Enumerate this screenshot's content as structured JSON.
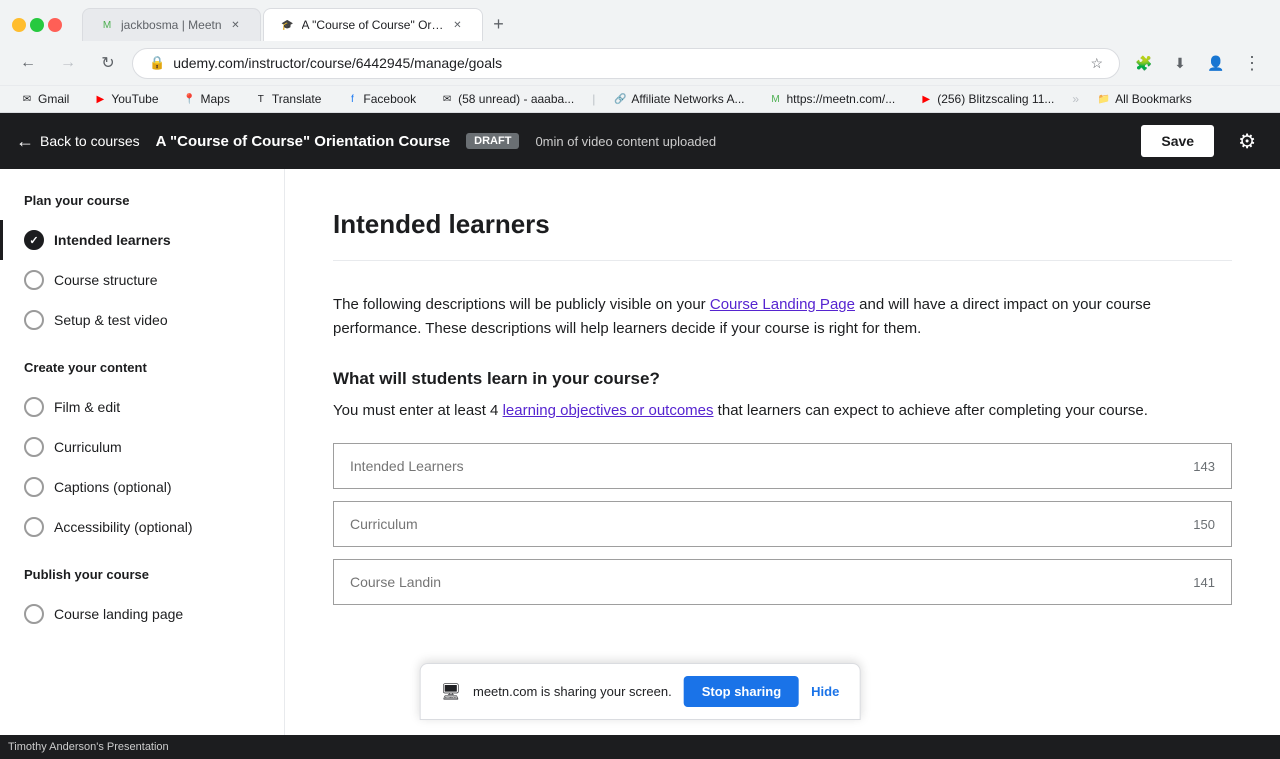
{
  "browser": {
    "tabs": [
      {
        "id": "tab1",
        "favicon": "M",
        "title": "jackbosma | Meetn",
        "active": false,
        "favicon_color": "#4CAF50"
      },
      {
        "id": "tab2",
        "favicon": "🎓",
        "title": "A \"Course of Course\" Orientati...",
        "active": true,
        "favicon_color": "#1a73e8"
      }
    ],
    "add_tab_label": "+",
    "address": "udemy.com/instructor/course/6442945/manage/goals",
    "nav": {
      "back_disabled": false,
      "forward_disabled": false,
      "reload_title": "Reload"
    },
    "bookmarks": [
      {
        "id": "bm1",
        "icon": "✉",
        "label": "Gmail"
      },
      {
        "id": "bm2",
        "icon": "▶",
        "label": "YouTube"
      },
      {
        "id": "bm3",
        "icon": "📍",
        "label": "Maps"
      },
      {
        "id": "bm4",
        "icon": "T",
        "label": "Translate"
      },
      {
        "id": "bm5",
        "icon": "f",
        "label": "Facebook"
      },
      {
        "id": "bm6",
        "icon": "✉",
        "label": "(58 unread) - aaaba..."
      },
      {
        "id": "bm7",
        "icon": "🔗",
        "label": "Affiliate Networks A..."
      },
      {
        "id": "bm8",
        "icon": "M",
        "label": "https://meetn.com/..."
      },
      {
        "id": "bm9",
        "icon": "▶",
        "label": "(256) Blitzscaling 11..."
      },
      {
        "id": "bm10",
        "icon": "📁",
        "label": "All Bookmarks"
      }
    ]
  },
  "app_header": {
    "back_label": "Back to courses",
    "course_title": "A \"Course of Course\" Orientation Course",
    "draft_label": "DRAFT",
    "video_status": "0min of video content uploaded",
    "save_label": "Save"
  },
  "sidebar": {
    "section1_title": "Plan your course",
    "section1_items": [
      {
        "id": "intended-learners",
        "label": "Intended learners",
        "completed": true,
        "active": true
      },
      {
        "id": "course-structure",
        "label": "Course structure",
        "completed": false,
        "active": false
      },
      {
        "id": "setup-test-video",
        "label": "Setup & test video",
        "completed": false,
        "active": false
      }
    ],
    "section2_title": "Create your content",
    "section2_items": [
      {
        "id": "film-edit",
        "label": "Film & edit",
        "completed": false,
        "active": false
      },
      {
        "id": "curriculum",
        "label": "Curriculum",
        "completed": false,
        "active": false
      },
      {
        "id": "captions",
        "label": "Captions (optional)",
        "completed": false,
        "active": false
      },
      {
        "id": "accessibility",
        "label": "Accessibility (optional)",
        "completed": false,
        "active": false
      }
    ],
    "section3_title": "Publish your course",
    "section3_items": [
      {
        "id": "course-landing-page",
        "label": "Course landing page",
        "completed": false,
        "active": false
      }
    ]
  },
  "content": {
    "page_title": "Intended learners",
    "description": "The following descriptions will be publicly visible on your ",
    "description_link": "Course Landing Page",
    "description_suffix": " and will have a direct impact on your course performance. These descriptions will help learners decide if your course is right for them.",
    "section_heading": "What will students learn in your course?",
    "sub_text_prefix": "You must enter at least 4 ",
    "sub_text_link": "learning objectives or outcomes",
    "sub_text_suffix": " that learners can expect to achieve after completing your course.",
    "inputs": [
      {
        "id": "input1",
        "placeholder": "Intended Learners",
        "char_count": "143"
      },
      {
        "id": "input2",
        "placeholder": "Curriculum",
        "char_count": "150"
      },
      {
        "id": "input3",
        "placeholder": "Course Landin",
        "char_count": "141"
      }
    ]
  },
  "screen_share": {
    "message": "meetn.com is sharing your screen.",
    "stop_label": "Stop sharing",
    "hide_label": "Hide"
  },
  "taskbar": {
    "label": "Timothy Anderson's Presentation"
  }
}
